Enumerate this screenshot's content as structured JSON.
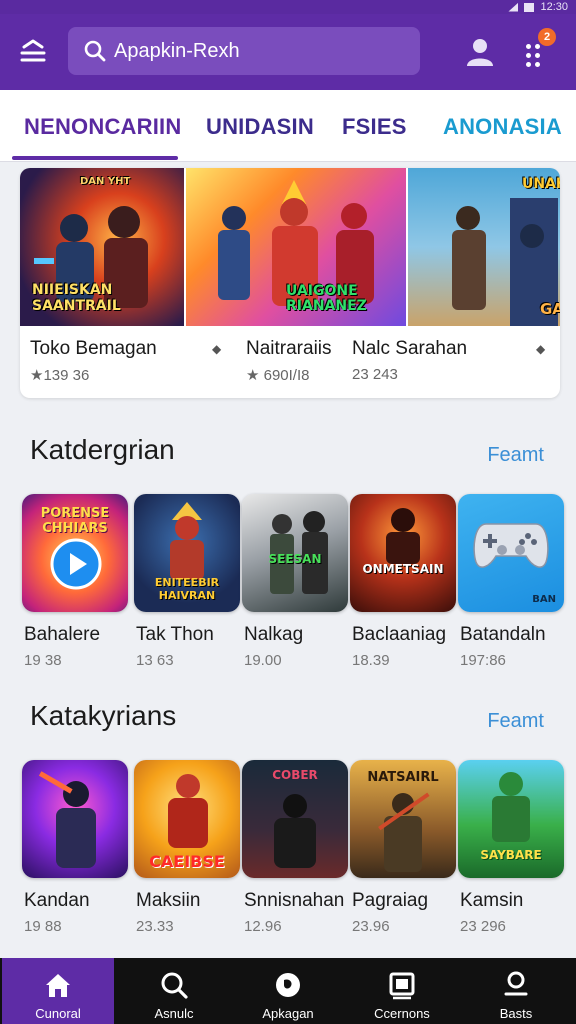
{
  "status_bar": {
    "time": "12:30"
  },
  "header": {
    "search_text": "Apapkin-Rexh",
    "badge_count": "2"
  },
  "tabs": [
    {
      "label": "NENONCARIIN",
      "color": "#5a2aa0",
      "active": true
    },
    {
      "label": "UNIDASIN",
      "color": "#3c2c8c"
    },
    {
      "label": "FSIES",
      "color": "#3c2c8c"
    },
    {
      "label": "ANONASIA",
      "color": "#1a9bd0"
    }
  ],
  "featured": {
    "items": [
      {
        "title": "Toko Bemagan",
        "meta": "★139 36",
        "cover_text": "NIIEISKAN SAANTRAIL",
        "cover_top": "DAN YHT"
      },
      {
        "title": "Naitraraiis",
        "meta": "★ 690I/I8",
        "cover_text": "UAIGONE RIANANEZ"
      },
      {
        "title": "Nalc Sarahan",
        "meta": "23 243",
        "cover_text": "GAM",
        "cover_top": "UNAKO"
      }
    ]
  },
  "sections": [
    {
      "title": "Katdergrian",
      "link": "Feamt",
      "items": [
        {
          "name": "Bahalere",
          "meta": "19 38",
          "text": "PORENSE CHHIARS"
        },
        {
          "name": "Tak Thon",
          "meta": "13 63",
          "text": "ENITEEBIR HAIVRAN"
        },
        {
          "name": "Nalkag",
          "meta": "19.00",
          "text": "SEESAN"
        },
        {
          "name": "Baclaaniag",
          "meta": "18.39",
          "text": "ONMETSAIN"
        },
        {
          "name": "Batandaln",
          "meta": "197:86",
          "text": "BAN"
        }
      ]
    },
    {
      "title": "Katakyrians",
      "link": "Feamt",
      "items": [
        {
          "name": "Kandan",
          "meta": "19 88",
          "text": ""
        },
        {
          "name": "Maksiin",
          "meta": "23.33",
          "text": "CAEIBSE"
        },
        {
          "name": "Snnisnahan",
          "meta": "12.96",
          "text": "COBER"
        },
        {
          "name": "Pagraiag",
          "meta": "23.96",
          "text": "NATSAIRL"
        },
        {
          "name": "Kamsin",
          "meta": "23 296",
          "text": "SAYBARE"
        }
      ]
    }
  ],
  "bottom_nav": [
    {
      "label": "Cunoral",
      "icon": "home-icon",
      "active": true
    },
    {
      "label": "Asnulc",
      "icon": "search-icon"
    },
    {
      "label": "Apkagan",
      "icon": "apps-icon"
    },
    {
      "label": "Ccernons",
      "icon": "library-icon"
    },
    {
      "label": "Basts",
      "icon": "profile-icon"
    }
  ]
}
